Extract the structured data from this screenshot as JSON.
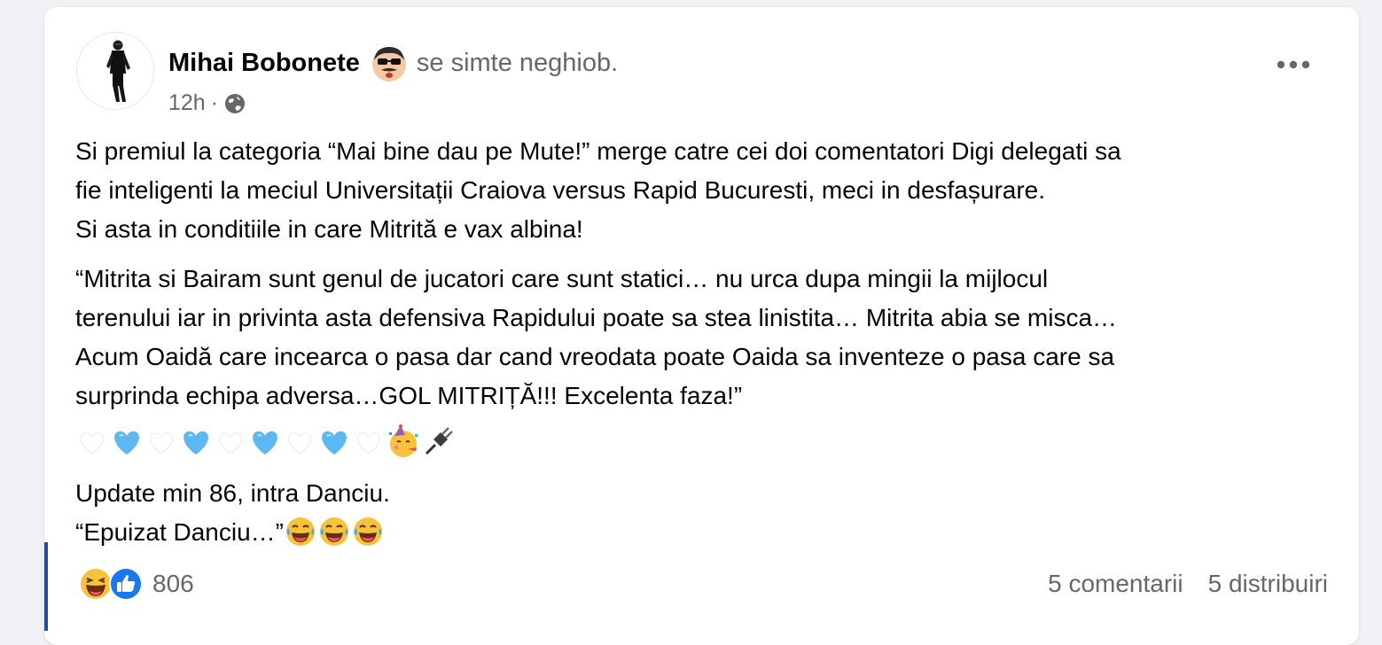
{
  "post": {
    "author": "Mihai Bobonete",
    "feeling": "se simte neghiob.",
    "time": "12h",
    "separator": "·",
    "icons": {
      "feeling": "foolish-face-icon",
      "privacy": "globe-icon",
      "more": "more-options-icon"
    },
    "paragraph1": [
      "Si premiul la categoria “Mai bine dau pe Mute!” merge catre cei doi comentatori Digi delegati sa",
      "fie inteligenti la meciul Universitații Craiova versus Rapid Bucuresti, meci in desfașurare.",
      "Si asta in conditiile in care Mitrită e vax albina!"
    ],
    "paragraph2": [
      "“Mitrita si Bairam sunt genul de jucatori care sunt statici… nu urca dupa mingii la mijlocul",
      "terenului iar in privinta asta defensiva Rapidului poate sa stea linistita… Mitrita abia se misca…",
      "Acum Oaidă care incearca o pasa dar cand vreodata poate Oaida sa inventeze o pasa care sa",
      "surprinda echipa adversa…GOL MITRIȚĂ!!! Excelenta faza!”"
    ],
    "emoji_row": [
      "white-heart-icon",
      "light-blue-heart-icon",
      "white-heart-icon",
      "light-blue-heart-icon",
      "white-heart-icon",
      "light-blue-heart-icon",
      "white-heart-icon",
      "light-blue-heart-icon",
      "white-heart-icon",
      "party-face-icon",
      "electric-plug-icon"
    ],
    "paragraph3": [
      "Update min 86, intra Danciu.",
      "“Epuizat Danciu…”"
    ],
    "trailing_emoji": [
      "laughing-tears-icon",
      "laughing-tears-icon",
      "laughing-tears-icon"
    ]
  },
  "footer": {
    "reaction_icons": [
      "haha-reaction-icon",
      "like-reaction-icon"
    ],
    "reaction_count": "806",
    "comments": "5 comentarii",
    "shares": "5 distribuiri"
  },
  "colors": {
    "secondary_text": "#65676b",
    "like_blue": "#1877f2",
    "accent_bar": "#2a4d99"
  }
}
